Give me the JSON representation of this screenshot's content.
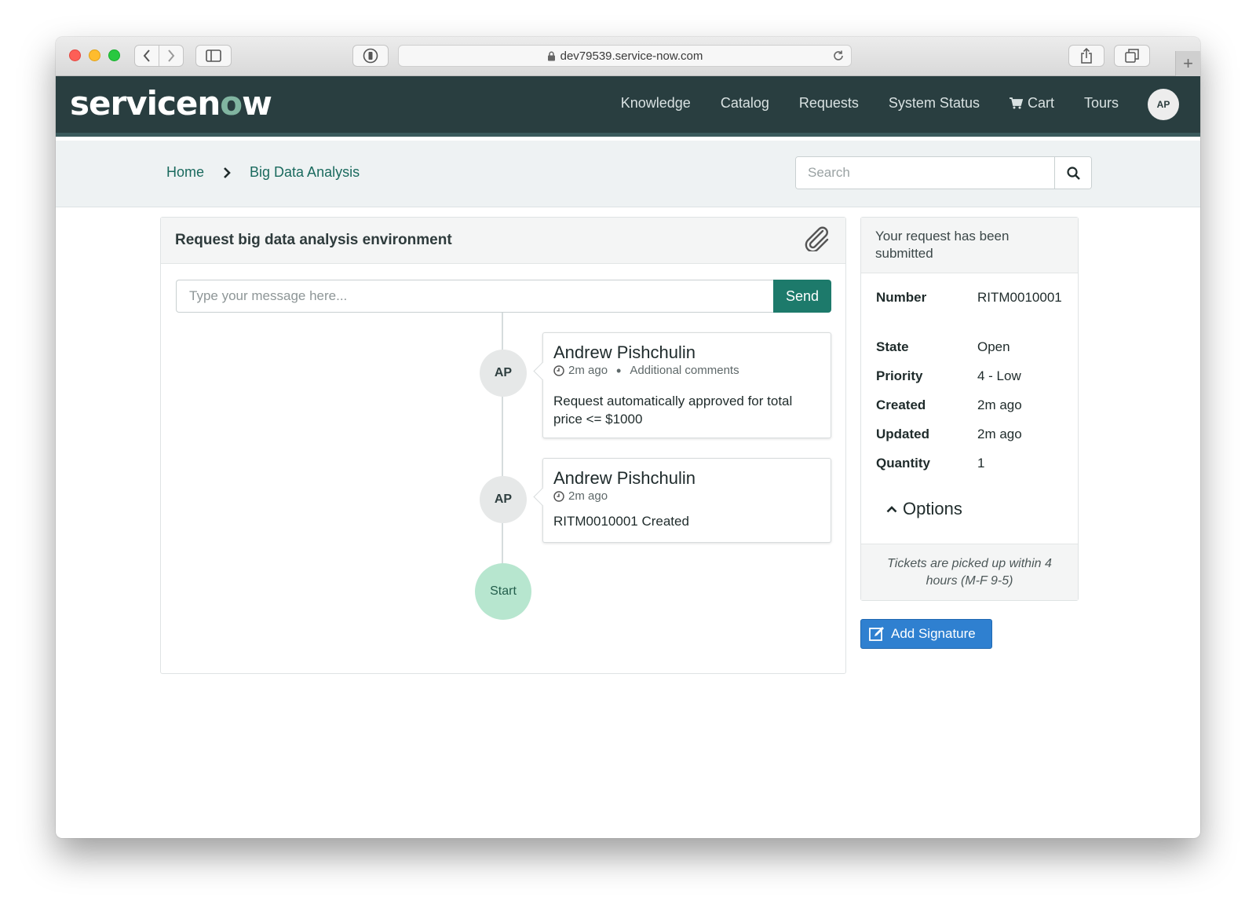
{
  "browser": {
    "url": "dev79539.service-now.com"
  },
  "brand": {
    "logo_part1": "servicen",
    "logo_o": "o",
    "logo_part2": "w"
  },
  "topnav": {
    "items": [
      {
        "label": "Knowledge"
      },
      {
        "label": "Catalog"
      },
      {
        "label": "Requests"
      },
      {
        "label": "System Status"
      },
      {
        "label": "Cart",
        "icon": "cart-icon"
      },
      {
        "label": "Tours"
      }
    ],
    "user_initials": "AP"
  },
  "breadcrumb": {
    "home": "Home",
    "current": "Big Data Analysis"
  },
  "search": {
    "placeholder": "Search"
  },
  "request": {
    "title": "Request big data analysis environment",
    "message_placeholder": "Type your message here...",
    "send_label": "Send",
    "entries": [
      {
        "initials": "AP",
        "author": "Andrew Pishchulin",
        "time": "2m ago",
        "type": "Additional comments",
        "body": "Request automatically approved for total price <= $1000"
      },
      {
        "initials": "AP",
        "author": "Andrew Pishchulin",
        "time": "2m ago",
        "body": "RITM0010001 Created"
      }
    ],
    "start_label": "Start"
  },
  "status": {
    "heading": "Your request has been submitted",
    "fields": [
      {
        "label": "Number",
        "value": "RITM0010001"
      },
      {
        "label": "State",
        "value": "Open"
      },
      {
        "label": "Priority",
        "value": "4 - Low"
      },
      {
        "label": "Created",
        "value": "2m ago"
      },
      {
        "label": "Updated",
        "value": "2m ago"
      },
      {
        "label": "Quantity",
        "value": "1"
      }
    ],
    "options_label": "Options",
    "footer": "Tickets are picked up within 4 hours (M-F 9-5)"
  },
  "signature": {
    "label": "Add Signature"
  },
  "colors": {
    "header_bg": "#293e40",
    "accent_green": "#1d7a6b",
    "logo_accent": "#81b5a1",
    "start_node": "#b7e6cf",
    "signature_blue": "#2f80d0"
  }
}
